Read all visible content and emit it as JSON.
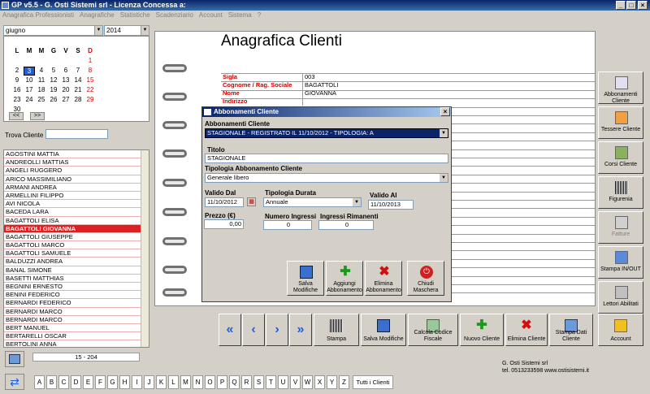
{
  "app": {
    "title": "GP v5.5 - G. Osti Sistemi srl - Licenza Concessa a:"
  },
  "menu": [
    "Anagrafica Professionisti",
    "Anagrafiche",
    "Statistiche",
    "Scadenziario",
    "Account",
    "Sistema",
    "?"
  ],
  "calendar": {
    "month": "giugno",
    "year": "2014",
    "headers": [
      "L",
      "M",
      "M",
      "G",
      "V",
      "S",
      "D"
    ],
    "weeks": [
      [
        "",
        "",
        "",
        "",
        "",
        "",
        "1"
      ],
      [
        "2",
        "3",
        "4",
        "5",
        "6",
        "7",
        "8"
      ],
      [
        "9",
        "10",
        "11",
        "12",
        "13",
        "14",
        "15"
      ],
      [
        "16",
        "17",
        "18",
        "19",
        "20",
        "21",
        "22"
      ],
      [
        "23",
        "24",
        "25",
        "26",
        "27",
        "28",
        "29"
      ],
      [
        "30",
        "",
        "",
        "",
        "",
        "",
        ""
      ]
    ],
    "selected_day": "3",
    "prev": "<<",
    "next": ">>"
  },
  "search": {
    "label": "Trova Cliente",
    "value": ""
  },
  "clients": [
    "AGOSTINI MATTIA",
    "ANDREOLLI MATTIAS",
    "ANGELI RUGGERO",
    "ARICO MASSIMILIANO",
    "ARMANI ANDREA",
    "ARMELLINI FILIPPO",
    "AVI NICOLA",
    "BACEDA LARA",
    "BAGATTOLI ELISA",
    "BAGATTOLI GIOVANNA",
    "BAGATTOLI GIUSEPPE",
    "BAGATTOLI MARCO",
    "BAGATTOLI SAMUELE",
    "BALDUZZI ANDREA",
    "BANAL SIMONE",
    "BASETTI MATTHIAS",
    "BEGNINI ERNESTO",
    "BENINI FEDERICO",
    "BERNARDI FEDERICO",
    "BERNARDI MARCO",
    "BERNARDI MARCO",
    "BERT MANUEL",
    "BERTARELLI OSCAR",
    "BERTOLINI ANNA"
  ],
  "selected_client_index": 9,
  "record_counter": "15 - 204",
  "alphabet": [
    "A",
    "B",
    "C",
    "D",
    "E",
    "F",
    "G",
    "H",
    "I",
    "J",
    "K",
    "L",
    "M",
    "N",
    "O",
    "P",
    "Q",
    "R",
    "S",
    "T",
    "U",
    "V",
    "W",
    "X",
    "Y",
    "Z"
  ],
  "all_clients_label": "Tutti i Clienti",
  "main": {
    "title": "Anagrafica Clienti",
    "fields": [
      {
        "label": "Sigla",
        "value": "003"
      },
      {
        "label": "Cognome / Rag. Sociale",
        "value": "BAGATTOLI"
      },
      {
        "label": "Nome",
        "value": "GIOVANNA"
      },
      {
        "label": "Indirizzo",
        "value": ""
      }
    ]
  },
  "right_buttons": [
    "Abbonamenti Cliente",
    "Tessere Cliente",
    "Corsi Cliente",
    "Figurenia",
    "Fatture",
    "Stampa IN/OUT",
    "Lettori Abilitati"
  ],
  "bottom_buttons": {
    "stampa": "Stampa",
    "salva": "Salva Modifiche",
    "calcola": "Calcola Codice Fiscale",
    "nuovo": "Nuovo Cliente",
    "elimina": "Elimina Cliente",
    "stampa_dati": "Stampa Dati Cliente",
    "account": "Account"
  },
  "dialog": {
    "title": "Abbonamenti Cliente",
    "section": "Abbonamenti Cliente",
    "subscription": "STAGIONALE - REGISTRATO IL 11/10/2012 - TIPOLOGIA: A",
    "titolo_label": "Titolo",
    "titolo_value": "STAGIONALE",
    "tipologia_label": "Tipologia Abbonamento Cliente",
    "tipologia_value": "Generale libero",
    "valido_dal_label": "Valido Dal",
    "valido_dal_value": "11/10/2012",
    "durata_label": "Tipologia Durata",
    "durata_value": "Annuale",
    "valido_al_label": "Valido Al",
    "valido_al_value": "11/10/2013",
    "prezzo_label": "Prezzo (€)",
    "prezzo_value": "0,00",
    "ingressi_label": "Numero Ingressi",
    "ingressi_value": "0",
    "rimanenti_label": "Ingressi Rimanenti",
    "rimanenti_value": "0",
    "buttons": {
      "salva": "Salva Modifiche",
      "aggiungi": "Aggiungi Abbonamento",
      "elimina": "Elimina Abbonamento",
      "chiudi": "Chiudi Maschera"
    }
  },
  "company": {
    "name": "G. Osti Sistemi srl",
    "contact": "tel. 0513233598 www.ostisistemi.it"
  },
  "colors": {
    "accent": "#e02020",
    "titlebar": "#0a246a",
    "nav_arrow": "#1e5fd6"
  }
}
